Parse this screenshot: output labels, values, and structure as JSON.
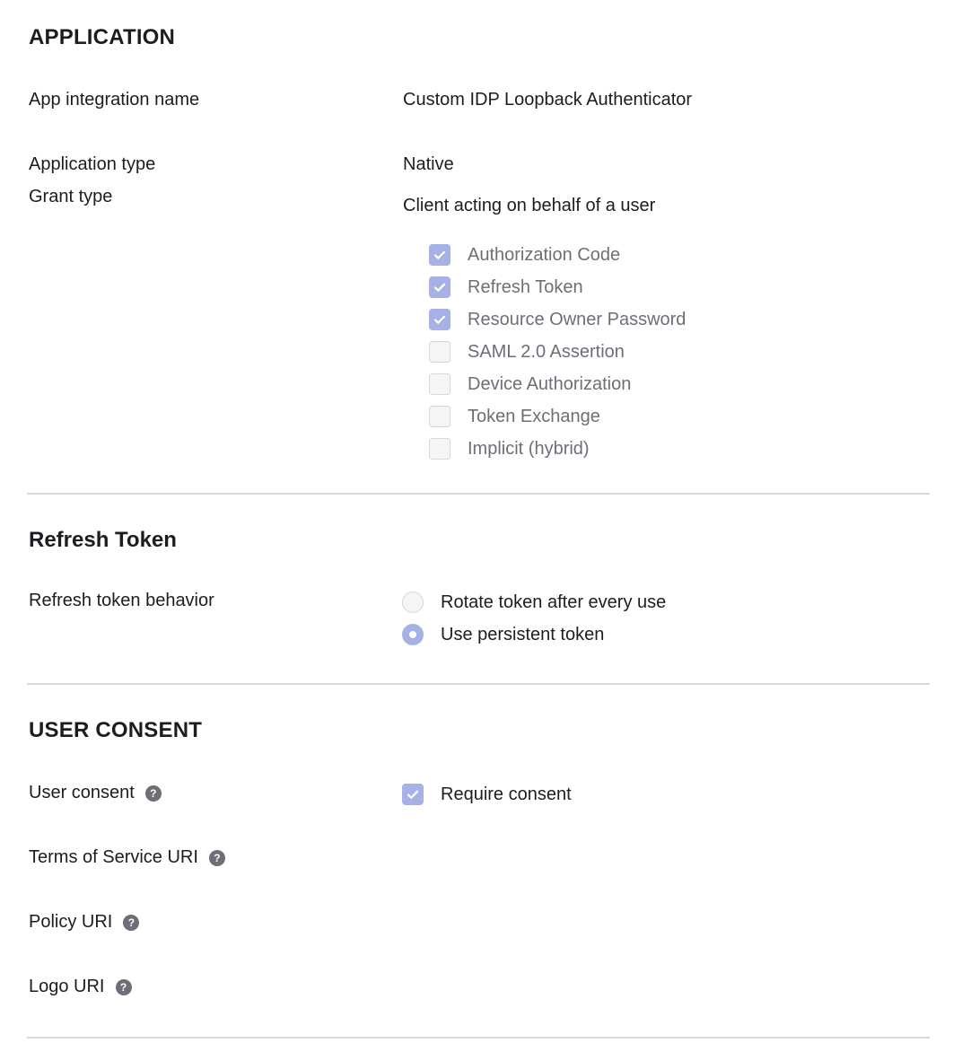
{
  "application": {
    "heading": "APPLICATION",
    "app_integration_name_label": "App integration name",
    "app_integration_name_value": "Custom IDP Loopback Authenticator",
    "application_type_label": "Application type",
    "application_type_value": "Native",
    "grant_type_label": "Grant type",
    "grant_type_value": "Client acting on behalf of a user",
    "grant_types": [
      {
        "label": "Authorization Code",
        "checked": true
      },
      {
        "label": "Refresh Token",
        "checked": true
      },
      {
        "label": "Resource Owner Password",
        "checked": true
      },
      {
        "label": "SAML 2.0 Assertion",
        "checked": false
      },
      {
        "label": "Device Authorization",
        "checked": false
      },
      {
        "label": "Token Exchange",
        "checked": false
      },
      {
        "label": "Implicit (hybrid)",
        "checked": false
      }
    ]
  },
  "refresh_token": {
    "heading": "Refresh Token",
    "behavior_label": "Refresh token behavior",
    "options": [
      {
        "label": "Rotate token after every use",
        "selected": false
      },
      {
        "label": "Use persistent token",
        "selected": true
      }
    ]
  },
  "user_consent": {
    "heading": "USER CONSENT",
    "user_consent_label": "User consent",
    "require_consent_label": "Require consent",
    "require_consent_checked": true,
    "terms_label": "Terms of Service URI",
    "policy_label": "Policy URI",
    "logo_label": "Logo URI",
    "help_glyph": "?"
  },
  "colors": {
    "accent": "#a7b1e6",
    "text": "#1d1d21",
    "muted": "#6e6e78",
    "divider": "#d7d7dc"
  },
  "icons": {
    "check": "checkmark-icon",
    "help": "help-circle-icon"
  }
}
